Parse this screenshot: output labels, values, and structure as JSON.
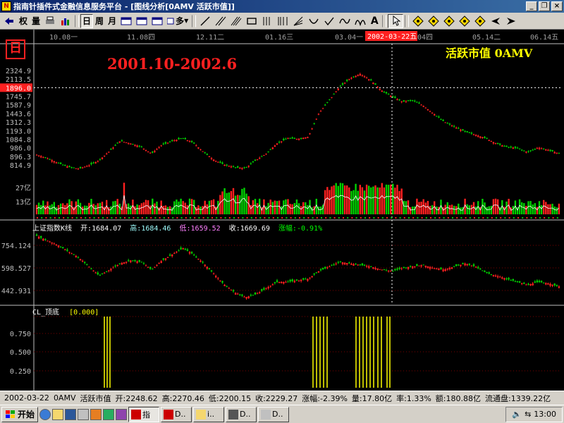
{
  "window": {
    "title": "指南针插件式金融信息服务平台 - [图线分析[0AMV 活跃市值]]"
  },
  "toolbar": {
    "items": [
      "权",
      "量",
      "日",
      "周",
      "月",
      "多"
    ]
  },
  "chart_header": {
    "period_badge": "日",
    "overlay_title": "2001.10-2002.6",
    "indicator_name": "活跃市值 0AMV",
    "date_ticks": [
      "10.08一",
      "11.08四",
      "12.11二",
      "01.16三",
      "03.04一",
      "04四",
      "05.14二",
      "06.14五"
    ],
    "cursor_date": "2002-03-22五"
  },
  "chart_data": [
    {
      "type": "candlestick",
      "name": "活跃市值",
      "y_ticks": [
        "2324.9",
        "2113.5",
        "1896.0",
        "1745.7",
        "1587.9",
        "1443.6",
        "1312.3",
        "1193.0",
        "1084.8",
        "986.0",
        "896.3",
        "814.9"
      ],
      "highlight_value": "1896.0",
      "close_path": [
        1080,
        1030,
        960,
        900,
        870,
        920,
        1000,
        1140,
        1290,
        1250,
        1200,
        1100,
        1230,
        1290,
        1330,
        1260,
        1120,
        1000,
        930,
        890,
        880,
        1000,
        1100,
        1250,
        1330,
        1320,
        1350,
        1700,
        1900,
        2100,
        2230,
        2300,
        2200,
        2050,
        1960,
        1880,
        1900,
        1820,
        1700,
        1580,
        1500,
        1430,
        1380,
        1330,
        1250,
        1200,
        1180,
        1120,
        1190,
        1150,
        1100
      ]
    },
    {
      "type": "bar",
      "name": "成交量",
      "y_ticks": [
        "27亿",
        "13亿"
      ]
    },
    {
      "type": "candlestick",
      "name": "上证指数K线",
      "open": "1684.07",
      "high": "1684.46",
      "low": "1659.52",
      "close": "1669.69",
      "change": "-0.91%",
      "labels": {
        "open": "开:",
        "high": "高:",
        "low": "低:",
        "close": "收:",
        "change": "涨幅:"
      },
      "y_ticks": [
        "754.124",
        "598.527",
        "442.931"
      ],
      "close_path": [
        820,
        790,
        760,
        720,
        680,
        620,
        560,
        600,
        640,
        660,
        650,
        600,
        660,
        700,
        740,
        700,
        640,
        570,
        500,
        450,
        420,
        440,
        480,
        520,
        520,
        530,
        540,
        590,
        620,
        650,
        640,
        630,
        620,
        600,
        590,
        610,
        620,
        630,
        610,
        600,
        620,
        640,
        620,
        580,
        560,
        540,
        520,
        500,
        520,
        510,
        490
      ]
    },
    {
      "type": "bar",
      "name": "CL_顶底",
      "value": "[0.000]",
      "y_ticks": [
        "0.750",
        "0.500",
        "0.250"
      ]
    }
  ],
  "status": {
    "date": "2002-03-22",
    "code": "0AMV",
    "name": "活跃市值",
    "open": "开:2248.62",
    "high": "高:2270.46",
    "low": "低:2200.15",
    "close": "收:2229.27",
    "change": "涨幅:-2.39%",
    "volume": "量:17.80亿",
    "rate": "率:1.33%",
    "amount": "额:180.88亿",
    "float": "流通盘:1339.22亿"
  },
  "taskbar": {
    "start_label": "开始",
    "tasks": [
      "指",
      "D..",
      "i..",
      "D..",
      "D.."
    ],
    "clock": "13:00"
  },
  "colors": {
    "up": "#ff2020",
    "down": "#00d000",
    "grid": "#7a0000",
    "text_cyan": "#a0ffff",
    "accent_red": "#ff3030",
    "title_yellow": "#ffff00"
  }
}
